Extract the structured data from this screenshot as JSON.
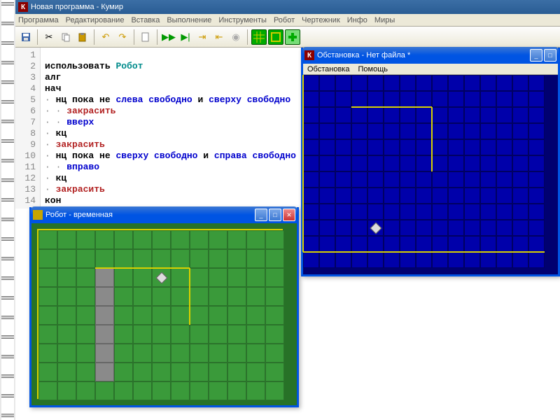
{
  "main": {
    "title": "Новая программа - Кумир"
  },
  "menu": {
    "items": [
      "Программа",
      "Редактирование",
      "Вставка",
      "Выполнение",
      "Инструменты",
      "Робот",
      "Чертежник",
      "Инфо",
      "Миры"
    ]
  },
  "code": {
    "lines": [
      1,
      2,
      3,
      4,
      5,
      6,
      7,
      8,
      9,
      10,
      11,
      12,
      13,
      14
    ],
    "l1a": "использовать",
    "l1b": "Робот",
    "l2": "алг",
    "l3": "нач",
    "l4a": "нц пока не",
    "l4b": "слева свободно",
    "l4c": "и",
    "l4d": "сверху свободно",
    "l5": "закрасить",
    "l6": "вверх",
    "l7": "кц",
    "l8": "закрасить",
    "l9a": "нц пока не",
    "l9b": "сверху свободно",
    "l9c": "и",
    "l9d": "справа свободно",
    "l10": "вправо",
    "l11": "кц",
    "l12": "закрасить",
    "l13": "кон"
  },
  "robotWin": {
    "title": "Робот - временная"
  },
  "envWin": {
    "title": "Обстановка - Нет файла *",
    "menu": [
      "Обстановка",
      "Помощь"
    ]
  },
  "robotField": {
    "cols": 13,
    "rows": 9,
    "cell": 27,
    "painted": [
      [
        3,
        2
      ],
      [
        3,
        3
      ],
      [
        3,
        4
      ],
      [
        3,
        5
      ],
      [
        3,
        6
      ],
      [
        3,
        7
      ]
    ],
    "diamond": [
      6,
      2
    ],
    "walls": [
      {
        "dir": "h",
        "r": 2,
        "c1": 3,
        "c2": 8
      },
      {
        "dir": "v",
        "r1": 2,
        "r2": 5,
        "c": 8
      }
    ]
  },
  "envField": {
    "cols": 15,
    "rows": 12,
    "cell": 23,
    "diamond": [
      4,
      9
    ],
    "walls": [
      {
        "dir": "h",
        "r": 2,
        "c1": 3,
        "c2": 8
      },
      {
        "dir": "v",
        "r1": 2,
        "r2": 6,
        "c": 8
      },
      {
        "dir": "h",
        "r": 11,
        "c1": 0,
        "c2": 15
      },
      {
        "dir": "v",
        "r1": 0,
        "r2": 11,
        "c": 0
      }
    ]
  }
}
